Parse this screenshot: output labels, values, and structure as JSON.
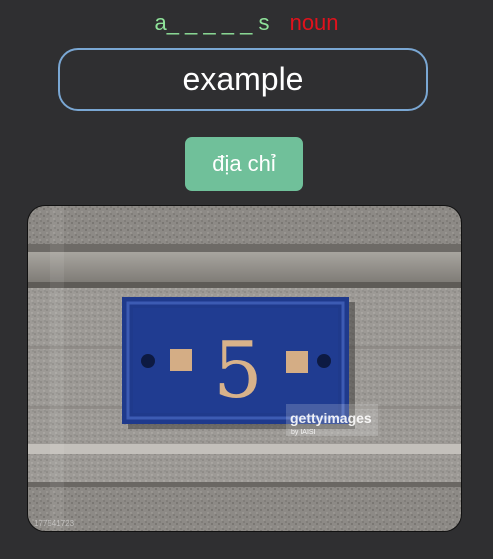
{
  "hint": {
    "pattern": "a_ _ _ _ _ s",
    "part_of_speech": "noun"
  },
  "answer_field": {
    "value": "example"
  },
  "meaning_button": {
    "label": "địa chỉ"
  },
  "photo": {
    "subject": "house number plaque",
    "plaque_number": "5",
    "watermark_brand": "gettyimages",
    "watermark_credit": "by IAISI",
    "image_id": "177541723"
  }
}
